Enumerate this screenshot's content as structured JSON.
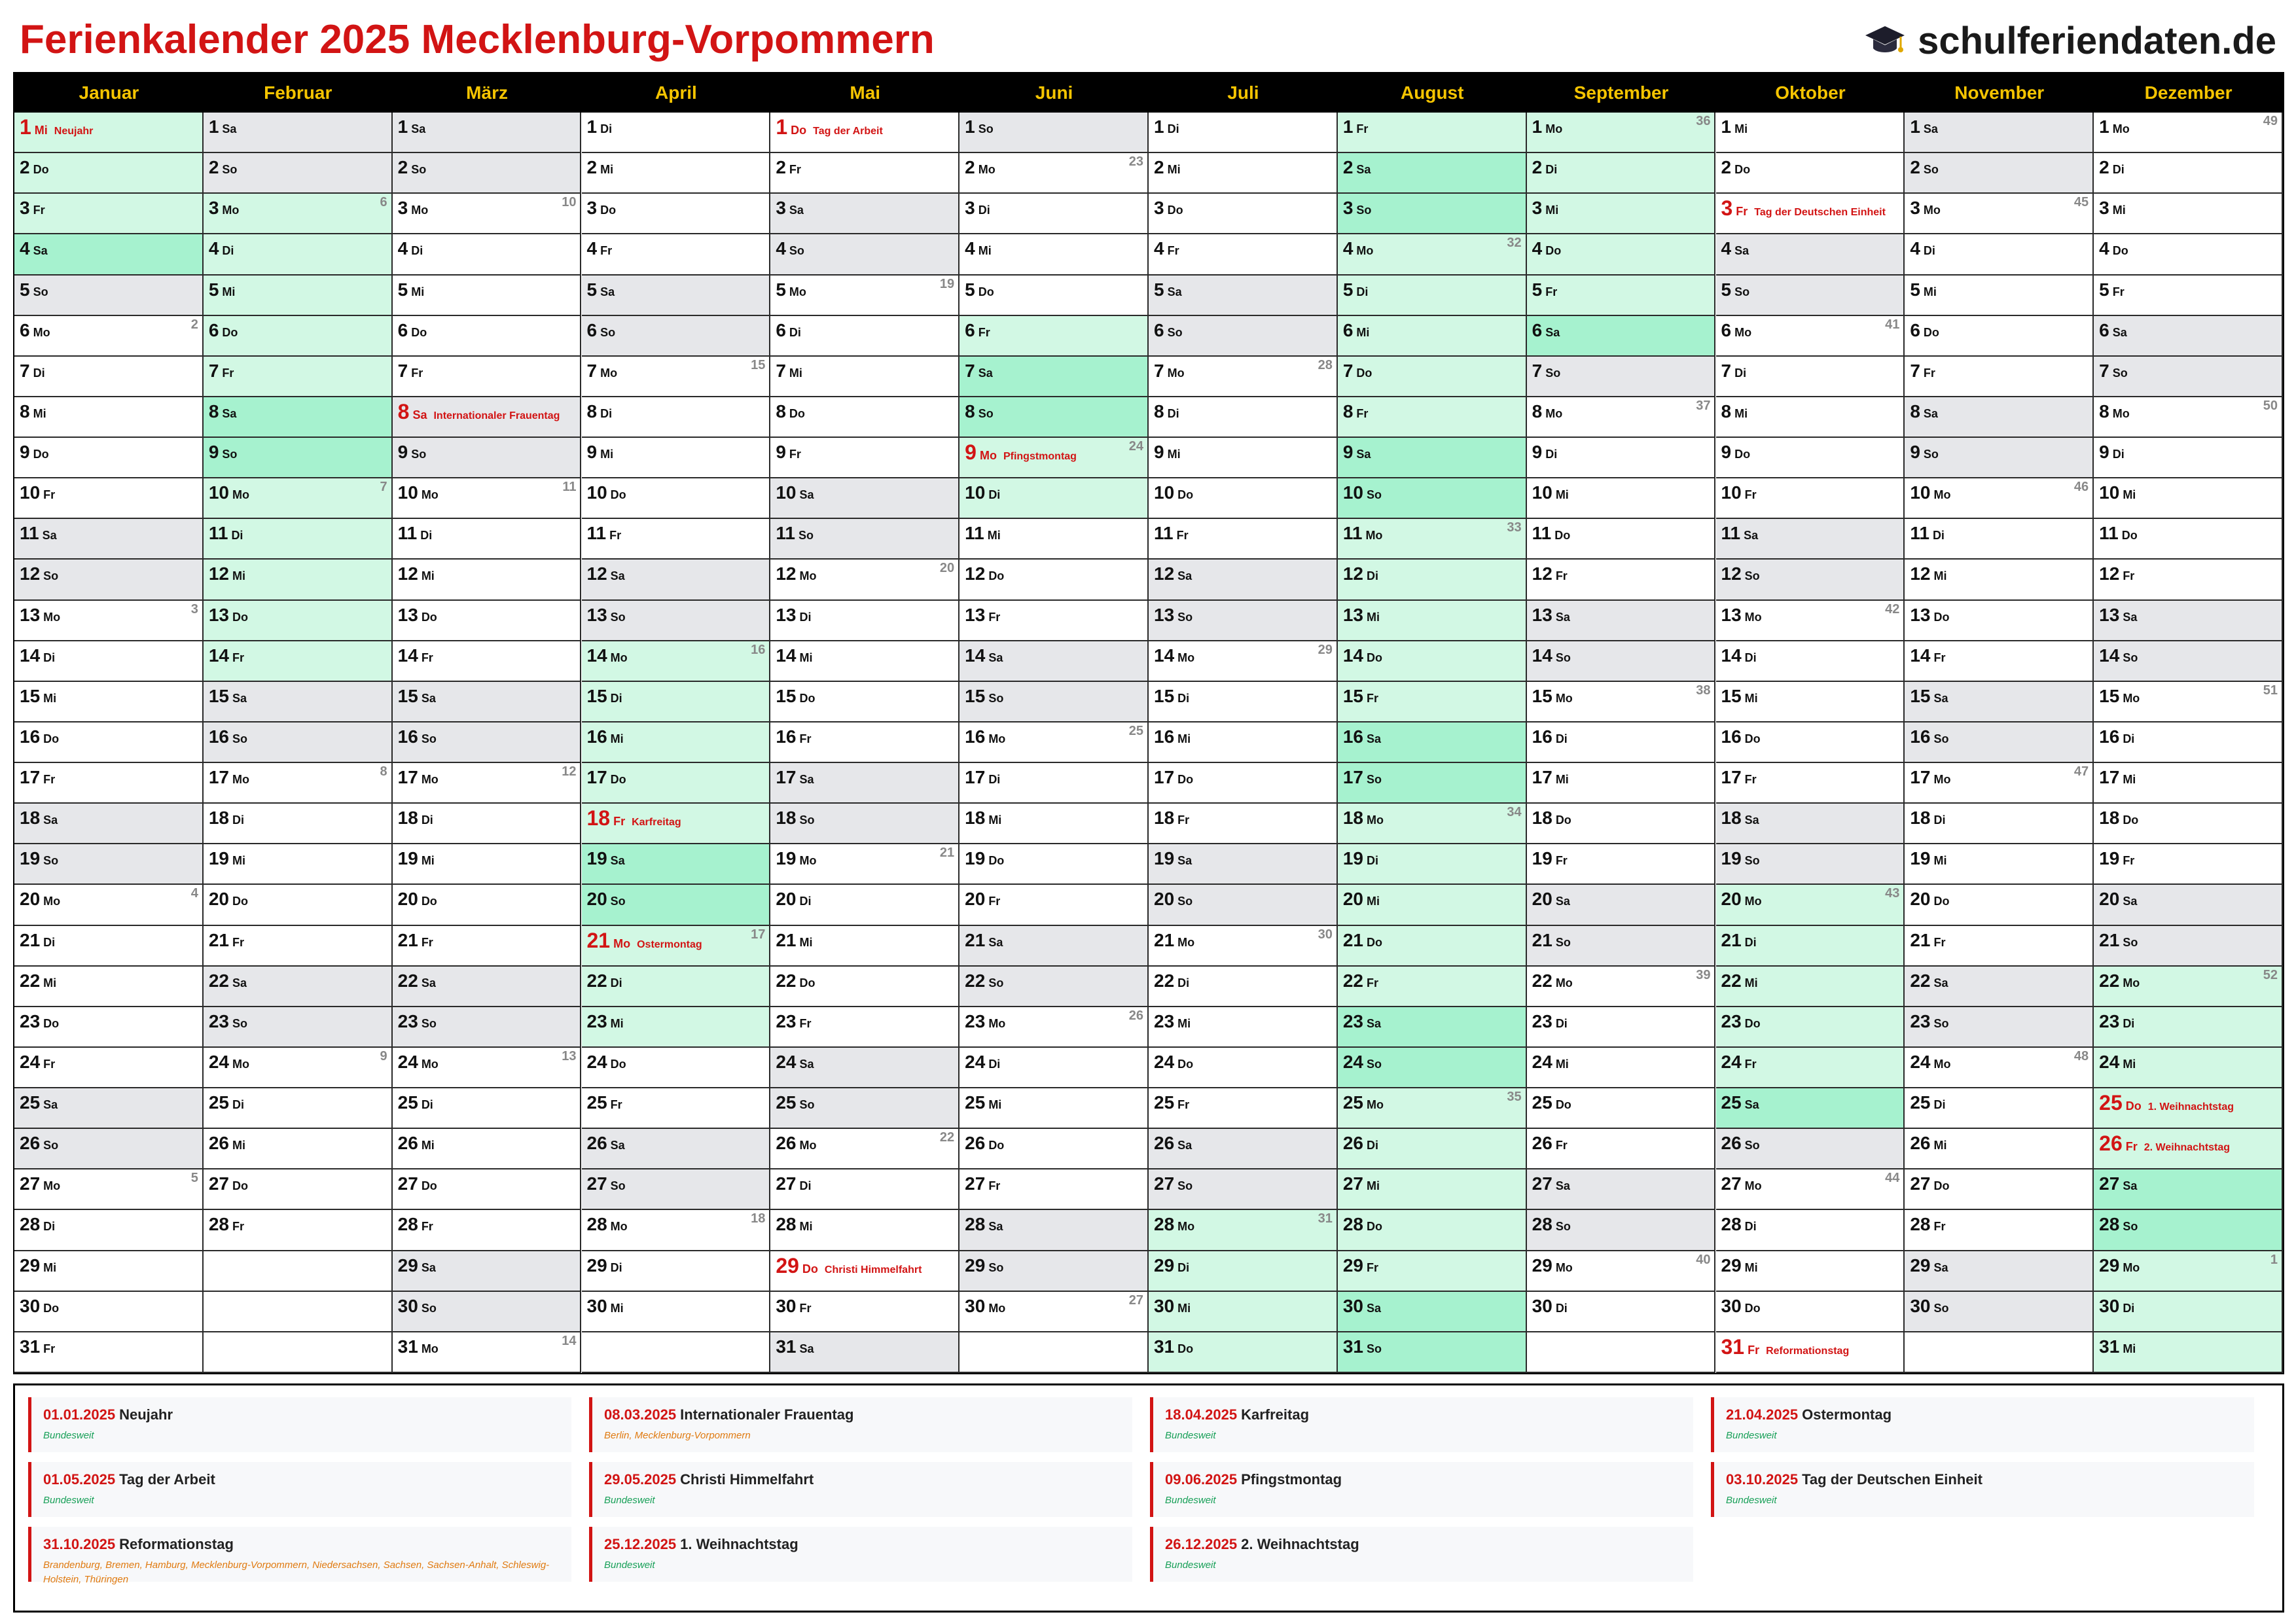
{
  "title": "Ferienkalender 2025 Mecklenburg-Vorpommern",
  "brand": {
    "text": "schulferiendaten.de",
    "icon": "graduation-cap-icon"
  },
  "colors": {
    "title": "#d21414",
    "month_header_text": "#f5c400",
    "weekend": "#e6e7ea",
    "ferien": "#d2f8e4",
    "ferien_weekend": "#a6f2cf",
    "holiday": "#d21414",
    "kw": "#888888"
  },
  "calendar": {
    "months": [
      "Januar",
      "Februar",
      "März",
      "April",
      "Mai",
      "Juni",
      "Juli",
      "August",
      "September",
      "Oktober",
      "November",
      "Dezember"
    ],
    "weekdays": [
      "Mo",
      "Di",
      "Mi",
      "Do",
      "Fr",
      "Sa",
      "So"
    ],
    "month_start_weekday": [
      2,
      5,
      5,
      1,
      3,
      6,
      1,
      4,
      0,
      2,
      5,
      0
    ],
    "month_lengths": [
      31,
      28,
      31,
      30,
      31,
      30,
      31,
      31,
      30,
      31,
      30,
      31
    ],
    "ferien_ranges": [
      [
        [
          1,
          1
        ],
        [
          1,
          4
        ]
      ],
      [
        [
          2,
          3
        ],
        [
          2,
          14
        ]
      ],
      [
        [
          4,
          14
        ],
        [
          4,
          23
        ]
      ],
      [
        [
          6,
          6
        ],
        [
          6,
          10
        ]
      ],
      [
        [
          7,
          28
        ],
        [
          9,
          6
        ]
      ],
      [
        [
          10,
          20
        ],
        [
          10,
          25
        ]
      ],
      [
        [
          12,
          22
        ],
        [
          12,
          31
        ]
      ]
    ],
    "holidays": [
      {
        "month": 1,
        "day": 1,
        "name": "Neujahr"
      },
      {
        "month": 3,
        "day": 8,
        "name": "Internationaler Frauentag"
      },
      {
        "month": 4,
        "day": 18,
        "name": "Karfreitag"
      },
      {
        "month": 4,
        "day": 21,
        "name": "Ostermontag"
      },
      {
        "month": 5,
        "day": 1,
        "name": "Tag der Arbeit"
      },
      {
        "month": 5,
        "day": 29,
        "name": "Christi Himmelfahrt"
      },
      {
        "month": 6,
        "day": 9,
        "name": "Pfingstmontag"
      },
      {
        "month": 10,
        "day": 3,
        "name": "Tag der Deutschen Einheit"
      },
      {
        "month": 10,
        "day": 31,
        "name": "Reformationstag"
      },
      {
        "month": 12,
        "day": 25,
        "name": "1. Weihnachtstag"
      },
      {
        "month": 12,
        "day": 26,
        "name": "2. Weihnachtstag"
      }
    ]
  },
  "legend": [
    {
      "date": "01.01.2025",
      "name": "Neujahr",
      "regions": "Bundesweit",
      "type": "bw"
    },
    {
      "date": "08.03.2025",
      "name": "Internationaler Frauentag",
      "regions": "Berlin, Mecklenburg-Vorpommern",
      "type": "reg"
    },
    {
      "date": "18.04.2025",
      "name": "Karfreitag",
      "regions": "Bundesweit",
      "type": "bw"
    },
    {
      "date": "21.04.2025",
      "name": "Ostermontag",
      "regions": "Bundesweit",
      "type": "bw"
    },
    {
      "date": "01.05.2025",
      "name": "Tag der Arbeit",
      "regions": "Bundesweit",
      "type": "bw"
    },
    {
      "date": "29.05.2025",
      "name": "Christi Himmelfahrt",
      "regions": "Bundesweit",
      "type": "bw"
    },
    {
      "date": "09.06.2025",
      "name": "Pfingstmontag",
      "regions": "Bundesweit",
      "type": "bw"
    },
    {
      "date": "03.10.2025",
      "name": "Tag der Deutschen Einheit",
      "regions": "Bundesweit",
      "type": "bw"
    },
    {
      "date": "31.10.2025",
      "name": "Reformationstag",
      "regions": "Brandenburg, Bremen, Hamburg, Mecklenburg-Vorpommern, Niedersachsen, Sachsen, Sachsen-Anhalt, Schleswig-Holstein, Thüringen",
      "type": "reg"
    },
    {
      "date": "25.12.2025",
      "name": "1. Weihnachtstag",
      "regions": "Bundesweit",
      "type": "bw"
    },
    {
      "date": "26.12.2025",
      "name": "2. Weihnachtstag",
      "regions": "Bundesweit",
      "type": "bw"
    }
  ]
}
